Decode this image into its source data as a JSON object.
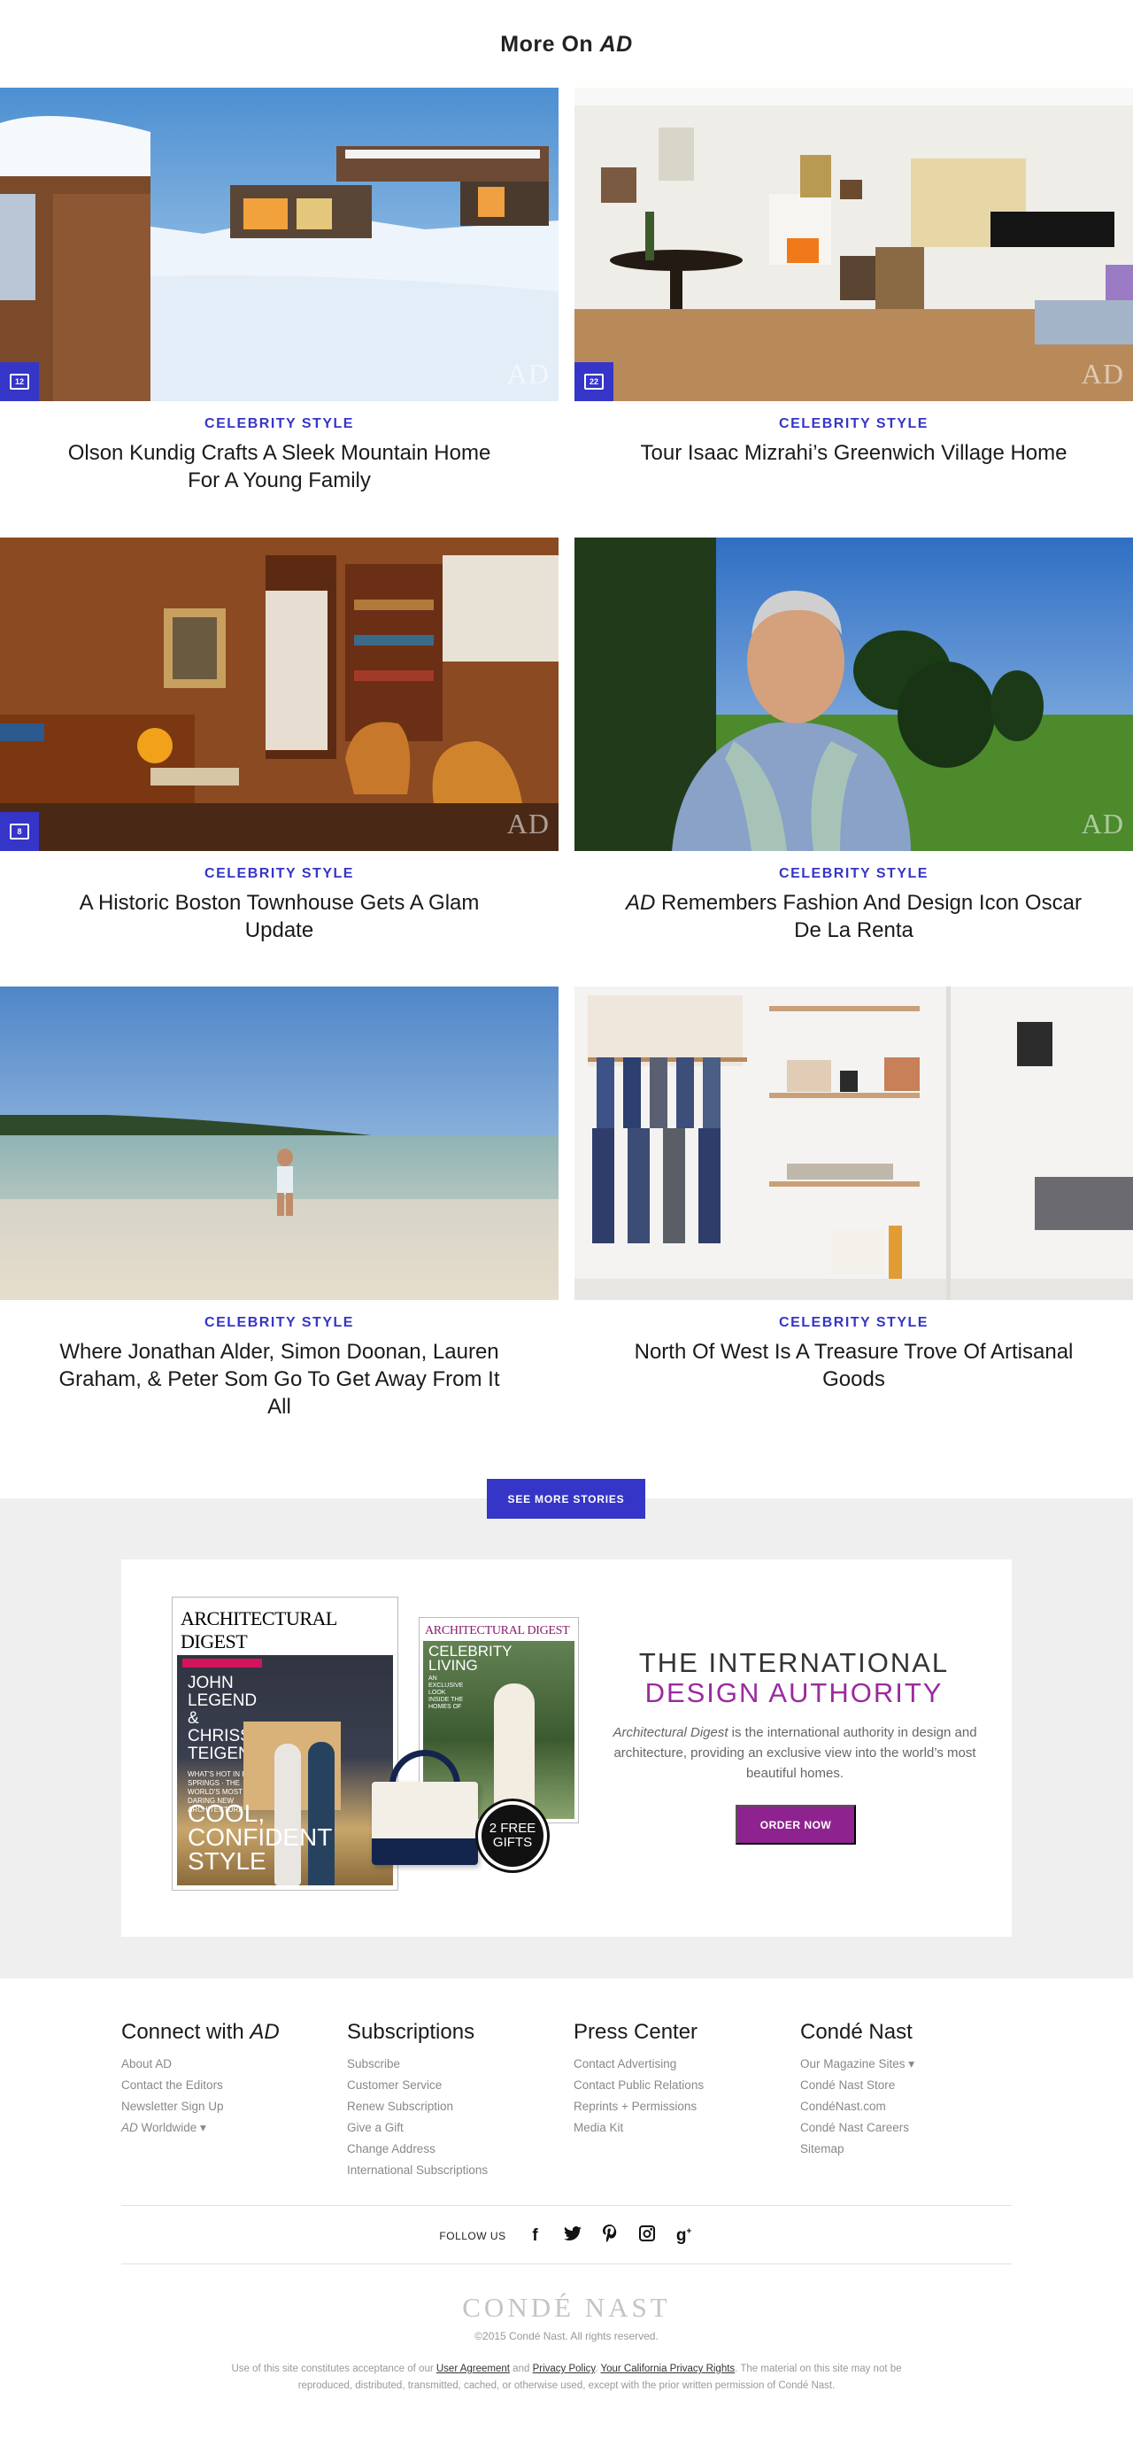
{
  "more_title": {
    "prefix": "More On ",
    "brand": "AD"
  },
  "watermark": "AD",
  "colors": {
    "accent": "#3535c8",
    "promo_accent": "#8e238f",
    "grey_band": "#efefef"
  },
  "cards": [
    {
      "category": "CELEBRITY STYLE",
      "headline": "Olson Kundig Crafts A Sleek Mountain Home For A Young Family",
      "gallery_count": "12",
      "image": "snowy-mountain-modern-house"
    },
    {
      "category": "CELEBRITY STYLE",
      "headline": "Tour Isaac Mizrahi’s Greenwich Village Home",
      "gallery_count": "22",
      "image": "white-living-room-fireplace-piano"
    },
    {
      "category": "CELEBRITY STYLE",
      "headline": "A Historic Boston Townhouse Gets A Glam Update",
      "gallery_count": "8",
      "image": "wood-paneled-library"
    },
    {
      "category": "CELEBRITY STYLE",
      "headline_em": "AD",
      "headline": " Remembers Fashion And Design Icon Oscar De La Renta",
      "image": "portrait-garden"
    },
    {
      "category": "CELEBRITY STYLE",
      "headline": "Where Jonathan Alder, Simon Doonan, Lauren Graham, & Peter Som Go To Get Away From It All",
      "image": "beach-shallow-water"
    },
    {
      "category": "CELEBRITY STYLE",
      "headline": "North Of West Is A Treasure Trove Of Artisanal Goods",
      "image": "shop-wall-aprons-shelves"
    }
  ],
  "see_more_label": "SEE MORE STORIES",
  "promo": {
    "mag1": {
      "masthead": "ARCHITECTURAL DIGEST",
      "cover_lines": [
        "JOHN",
        "LEGEND",
        "&",
        "CHRISSY",
        "TEIGEN"
      ],
      "small_lines": "WHAT'S HOT IN PALM SPRINGS · THE WORLD'S MOST DARING NEW ARCHITECTURE",
      "big_lines": [
        "COOL,",
        "CONFIDENT",
        "STYLE"
      ]
    },
    "mag2": {
      "masthead": "ARCHITECTURAL DIGEST",
      "cover_lines": [
        "CELEBRITY",
        "LIVING"
      ],
      "small_lines": "AN EXCLUSIVE LOOK INSIDE THE HOMES OF"
    },
    "gifts_line1": "2 FREE",
    "gifts_line2": "GIFTS",
    "headline1": "THE INTERNATIONAL",
    "headline2": "DESIGN AUTHORITY",
    "copy_em": "Architectural Digest",
    "copy": " is the international authority in design and architecture, providing an exclusive view into the world’s most beautiful homes.",
    "order_label": "ORDER NOW"
  },
  "footer": {
    "columns": [
      {
        "title_prefix": "Connect with ",
        "title_em": "AD",
        "links": [
          "About AD",
          "Contact the Editors",
          "Newsletter Sign Up"
        ],
        "last_link_em": "AD",
        "last_link_rest": " Worldwide ▾"
      },
      {
        "title": "Subscriptions",
        "links": [
          "Subscribe",
          "Customer Service",
          "Renew Subscription",
          "Give a Gift",
          "Change Address",
          "International Subscriptions"
        ]
      },
      {
        "title": "Press Center",
        "links": [
          "Contact Advertising",
          "Contact Public Relations",
          "Reprints + Permissions",
          "Media Kit"
        ]
      },
      {
        "title": "Condé Nast",
        "links": [
          "Our Magazine Sites ▾",
          "Condé Nast Store",
          "CondéNast.com",
          "Condé Nast Careers",
          "Sitemap"
        ]
      }
    ],
    "follow_label": "FOLLOW US",
    "social_icons": [
      "facebook-icon",
      "twitter-icon",
      "pinterest-icon",
      "instagram-icon",
      "google-plus-icon"
    ],
    "logo_text": "CONDÉ NAST",
    "copyright": "©2015 Condé Nast. All rights reserved.",
    "legal_1": "Use of this site constitutes acceptance of our ",
    "legal_ua": "User Agreement",
    "legal_2": " and ",
    "legal_pp": "Privacy Policy",
    "legal_3": ". ",
    "legal_ca": "Your California Privacy Rights",
    "legal_4": ". The material on this site may not be reproduced, distributed, transmitted, cached, or otherwise used, except with the prior written permission of Condé Nast."
  }
}
